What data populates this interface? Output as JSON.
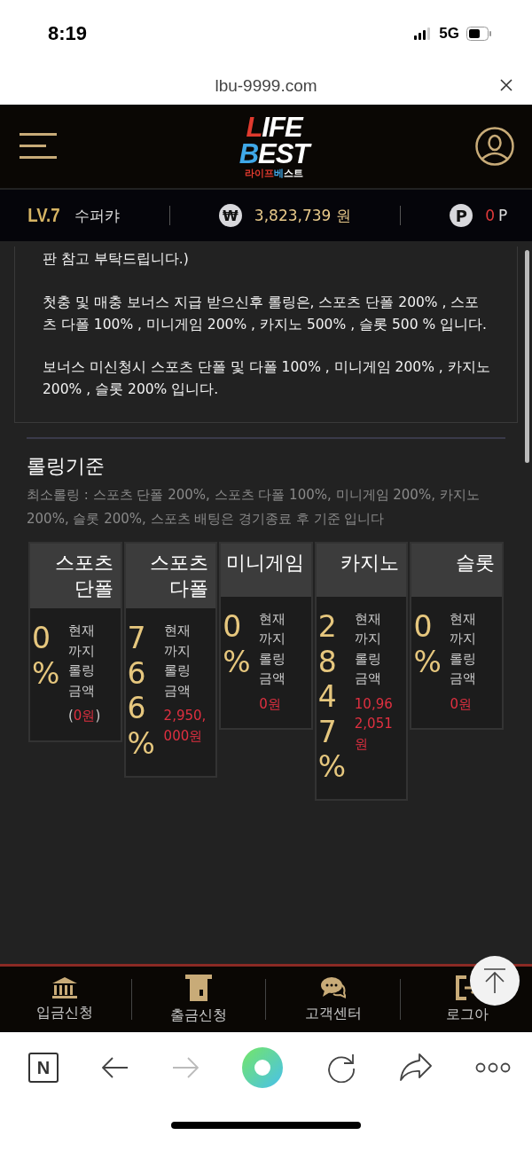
{
  "status_bar": {
    "time": "8:19",
    "network": "5G"
  },
  "address_bar": {
    "url": "lbu-9999.com"
  },
  "header": {
    "logo": {
      "line1_accent": "L",
      "line1_rest": "IFE",
      "line2_accent": "B",
      "line2_rest": "EST",
      "sub_red": "라이프",
      "sub_blue": "베",
      "sub_white": "스트"
    }
  },
  "user_bar": {
    "level": "LV.7",
    "nickname": "수퍼캬",
    "currency_symbol": "₩",
    "balance": "3,823,739 원",
    "point_symbol": "P",
    "points": "0",
    "points_unit": "P"
  },
  "notice": {
    "paragraphs": [
      "판 참고 부탁드립니다.)",
      "첫충 및 매충 보너스 지급 받으신후 롤링은, 스포츠 단폴 200% , 스포츠 다폴 100% , 미니게임 200% , 카지노 500% , 슬롯 500 % 입니다.",
      "보너스 미신청시 스포츠 단폴 및 다폴 100% , 미니게임 200% , 카지노 200% , 슬롯 200% 입니다."
    ]
  },
  "rolling": {
    "title": "롤링기준",
    "description": "최소롤링 : 스포츠 단폴 200%, 스포츠 다폴 100%, 미니게임 200%, 카지노 200%, 슬롯 200%, 스포츠 배팅은 경기종료 후 기준 입니다",
    "cards": [
      {
        "name": "스포츠 단폴",
        "percent": "0%",
        "label": "현재까지 롤링금액",
        "amount": "0원",
        "open": "(",
        "close": ")"
      },
      {
        "name": "스포츠 다폴",
        "percent": "766%",
        "label": "현재까지 롤링금액",
        "amount": "2,950,000원"
      },
      {
        "name": "미니게임",
        "percent": "0%",
        "label": "현재까지 롤링금액",
        "amount": "0원"
      },
      {
        "name": "카지노",
        "percent": "2847%",
        "label": "현재까지 롤링금액",
        "amount": "10,962,051원"
      },
      {
        "name": "슬롯",
        "percent": "0%",
        "label": "현재까지 롤링금액",
        "amount": "0원"
      }
    ]
  },
  "bottom_nav": [
    {
      "kind": "bank",
      "label": "입금신청"
    },
    {
      "kind": "atm",
      "label": "출금신청"
    },
    {
      "kind": "chat",
      "label": "고객센터"
    },
    {
      "kind": "logout",
      "label": "로그아"
    }
  ],
  "browser_toolbar": [
    {
      "kind": "naver",
      "label": "N",
      "disabled": false
    },
    {
      "kind": "back",
      "disabled": false
    },
    {
      "kind": "forward",
      "disabled": true
    },
    {
      "kind": "home",
      "disabled": false
    },
    {
      "kind": "reload",
      "disabled": false
    },
    {
      "kind": "share",
      "disabled": false
    },
    {
      "kind": "more",
      "disabled": false
    }
  ]
}
